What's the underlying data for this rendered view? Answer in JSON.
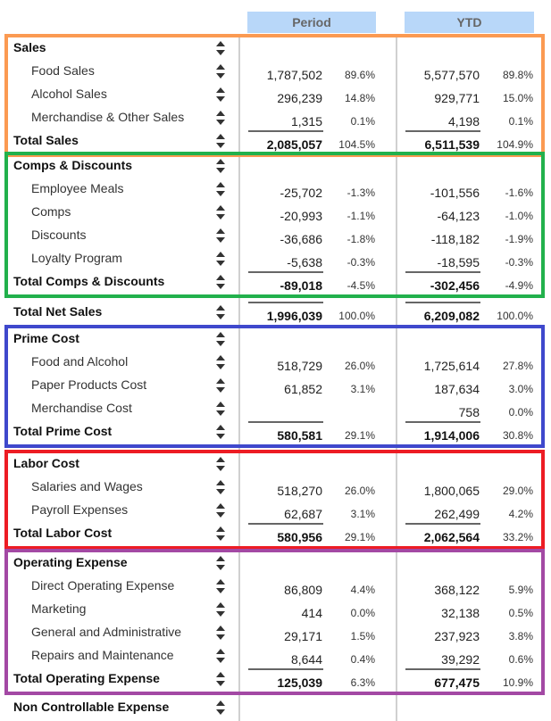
{
  "columns": {
    "period": "Period",
    "ytd": "YTD"
  },
  "colors": {
    "header_bg": "#b8d7f9",
    "sales": "#fb9a52",
    "comps": "#22b14c",
    "prime": "#3f48cc",
    "labor": "#ed1c24",
    "operating": "#a349a4"
  },
  "sections": {
    "sales": {
      "title": "Sales",
      "items": [
        {
          "label": "Food Sales",
          "period": "1,787,502",
          "period_pct": "89.6%",
          "ytd": "5,577,570",
          "ytd_pct": "89.8%"
        },
        {
          "label": "Alcohol Sales",
          "period": "296,239",
          "period_pct": "14.8%",
          "ytd": "929,771",
          "ytd_pct": "15.0%"
        },
        {
          "label": "Merchandise & Other Sales",
          "period": "1,315",
          "period_pct": "0.1%",
          "ytd": "4,198",
          "ytd_pct": "0.1%"
        }
      ],
      "total": {
        "label": "Total Sales",
        "period": "2,085,057",
        "period_pct": "104.5%",
        "ytd": "6,511,539",
        "ytd_pct": "104.9%"
      }
    },
    "comps": {
      "title": "Comps & Discounts",
      "items": [
        {
          "label": "Employee Meals",
          "period": "-25,702",
          "period_pct": "-1.3%",
          "ytd": "-101,556",
          "ytd_pct": "-1.6%"
        },
        {
          "label": "Comps",
          "period": "-20,993",
          "period_pct": "-1.1%",
          "ytd": "-64,123",
          "ytd_pct": "-1.0%"
        },
        {
          "label": "Discounts",
          "period": "-36,686",
          "period_pct": "-1.8%",
          "ytd": "-118,182",
          "ytd_pct": "-1.9%"
        },
        {
          "label": "Loyalty Program",
          "period": "-5,638",
          "period_pct": "-0.3%",
          "ytd": "-18,595",
          "ytd_pct": "-0.3%"
        }
      ],
      "total": {
        "label": "Total Comps & Discounts",
        "period": "-89,018",
        "period_pct": "-4.5%",
        "ytd": "-302,456",
        "ytd_pct": "-4.9%"
      }
    },
    "net_sales": {
      "label": "Total Net Sales",
      "period": "1,996,039",
      "period_pct": "100.0%",
      "ytd": "6,209,082",
      "ytd_pct": "100.0%"
    },
    "prime": {
      "title": "Prime Cost",
      "items": [
        {
          "label": "Food and Alcohol",
          "period": "518,729",
          "period_pct": "26.0%",
          "ytd": "1,725,614",
          "ytd_pct": "27.8%"
        },
        {
          "label": "Paper Products Cost",
          "period": "61,852",
          "period_pct": "3.1%",
          "ytd": "187,634",
          "ytd_pct": "3.0%"
        },
        {
          "label": "Merchandise Cost",
          "period": "",
          "period_pct": "",
          "ytd": "758",
          "ytd_pct": "0.0%"
        }
      ],
      "total": {
        "label": "Total Prime Cost",
        "period": "580,581",
        "period_pct": "29.1%",
        "ytd": "1,914,006",
        "ytd_pct": "30.8%"
      }
    },
    "labor": {
      "title": "Labor Cost",
      "items": [
        {
          "label": "Salaries and Wages",
          "period": "518,270",
          "period_pct": "26.0%",
          "ytd": "1,800,065",
          "ytd_pct": "29.0%"
        },
        {
          "label": "Payroll Expenses",
          "period": "62,687",
          "period_pct": "3.1%",
          "ytd": "262,499",
          "ytd_pct": "4.2%"
        }
      ],
      "total": {
        "label": "Total Labor Cost",
        "period": "580,956",
        "period_pct": "29.1%",
        "ytd": "2,062,564",
        "ytd_pct": "33.2%"
      }
    },
    "operating": {
      "title": "Operating Expense",
      "items": [
        {
          "label": "Direct Operating Expense",
          "period": "86,809",
          "period_pct": "4.4%",
          "ytd": "368,122",
          "ytd_pct": "5.9%"
        },
        {
          "label": "Marketing",
          "period": "414",
          "period_pct": "0.0%",
          "ytd": "32,138",
          "ytd_pct": "0.5%"
        },
        {
          "label": "General and Administrative",
          "period": "29,171",
          "period_pct": "1.5%",
          "ytd": "237,923",
          "ytd_pct": "3.8%"
        },
        {
          "label": "Repairs and Maintenance",
          "period": "8,644",
          "period_pct": "0.4%",
          "ytd": "39,292",
          "ytd_pct": "0.6%"
        }
      ],
      "total": {
        "label": "Total Operating Expense",
        "period": "125,039",
        "period_pct": "6.3%",
        "ytd": "677,475",
        "ytd_pct": "10.9%"
      }
    },
    "non_controllable": {
      "title": "Non Controllable Expense"
    }
  }
}
